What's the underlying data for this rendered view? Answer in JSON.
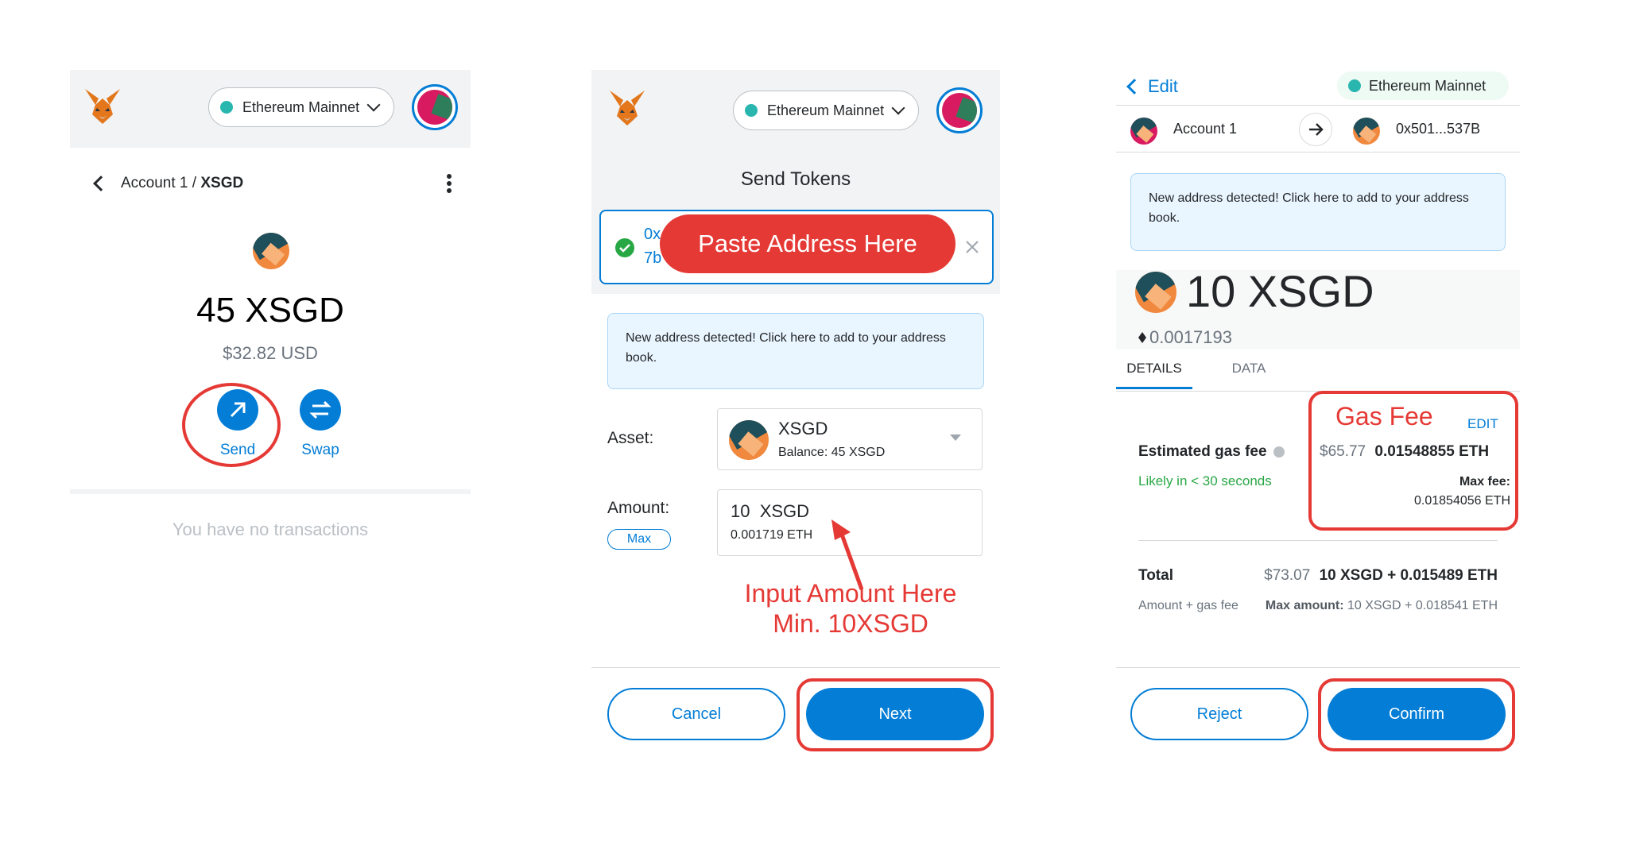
{
  "colors": {
    "primary": "#037dd6",
    "annotation": "#e53935",
    "success": "#28a745",
    "network_dot": "#29b6af"
  },
  "panel1": {
    "network": "Ethereum Mainnet",
    "account_crumb": "Account 1 / ",
    "token_crumb": "XSGD",
    "balance": "45 XSGD",
    "usd_value": "$32.82 USD",
    "send_label": "Send",
    "swap_label": "Swap",
    "empty_text": "You have no transactions"
  },
  "panel2": {
    "network": "Ethereum Mainnet",
    "title": "Send Tokens",
    "recipient_line1": "0x",
    "recipient_line2": "7b",
    "paste_annotation": "Paste Address Here",
    "notice": "New address detected! Click here to add to your address book.",
    "asset_label": "Asset:",
    "asset_name": "XSGD",
    "asset_balance": "Balance: 45 XSGD",
    "amount_label": "Amount:",
    "max_label": "Max",
    "amount_value": "10  XSGD",
    "amount_eth": "0.001719 ETH",
    "amount_annotation_1": "Input Amount Here",
    "amount_annotation_2": "Min. 10XSGD",
    "cancel_label": "Cancel",
    "next_label": "Next"
  },
  "panel3": {
    "edit_label": "Edit",
    "network": "Ethereum Mainnet",
    "from_account": "Account 1",
    "to_address": "0x501...537B",
    "notice": "New address detected! Click here to add to your address book.",
    "amount": "10 XSGD",
    "eth_amount": "0.0017193",
    "tabs": [
      "DETAILS",
      "DATA"
    ],
    "gas_annotation": "Gas Fee",
    "edit_gas": "EDIT",
    "gas_label": "Estimated gas fee",
    "gas_usd": "$65.77",
    "gas_eth": "0.01548855 ETH",
    "likely": "Likely in < 30 seconds",
    "max_fee_label": "Max fee:",
    "max_fee_value": "0.01854056 ETH",
    "total_label": "Total",
    "total_usd": "$73.07",
    "total_value": "10 XSGD + 0.015489 ETH",
    "amount_gas_label": "Amount + gas fee",
    "max_amount_label": "Max amount:",
    "max_amount_value": "10 XSGD + 0.018541 ETH",
    "reject_label": "Reject",
    "confirm_label": "Confirm"
  }
}
